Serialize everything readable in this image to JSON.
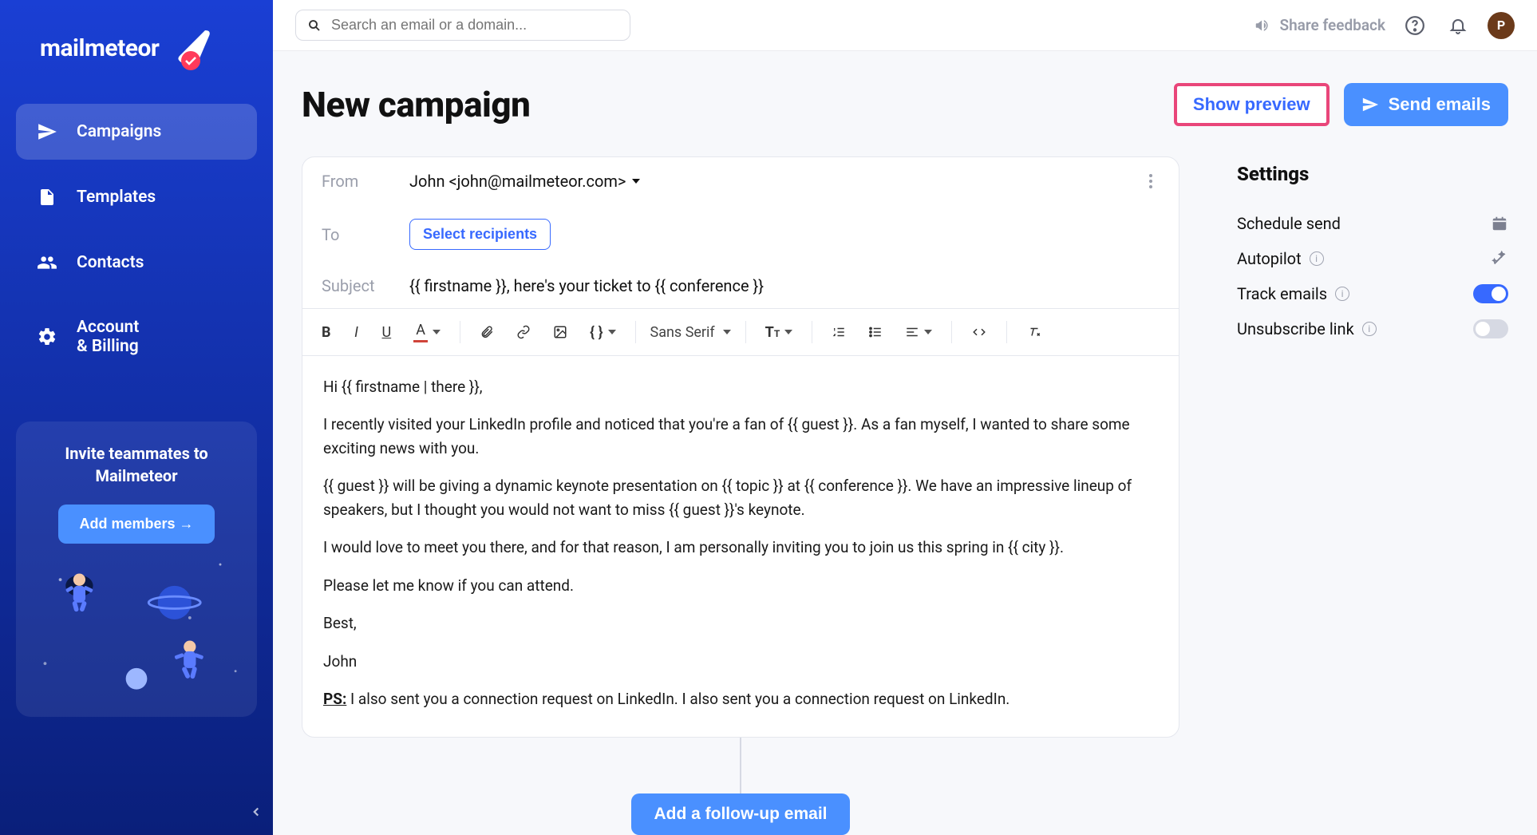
{
  "brand": {
    "name": "mailmeteor"
  },
  "search": {
    "placeholder": "Search an email or a domain..."
  },
  "topbar": {
    "feedback": "Share feedback",
    "avatar_initial": "P"
  },
  "nav": {
    "campaigns": "Campaigns",
    "templates": "Templates",
    "contacts": "Contacts",
    "account_billing_line1": "Account",
    "account_billing_line2": "& Billing"
  },
  "invite": {
    "title": "Invite teammates to Mailmeteor",
    "button": "Add members →"
  },
  "page": {
    "title": "New campaign",
    "show_preview": "Show preview",
    "send_emails": "Send emails",
    "follow_up": "Add a follow-up email"
  },
  "compose": {
    "from_label": "From",
    "from_value": "John <john@mailmeteor.com>",
    "to_label": "To",
    "select_recipients": "Select recipients",
    "subject_label": "Subject",
    "subject_value": "{{ firstname }}, here's your ticket to {{ conference }}",
    "font": "Sans Serif"
  },
  "body": {
    "p1": "Hi {{ firstname | there }},",
    "p2": "I recently visited your LinkedIn profile and noticed that you're a fan of {{ guest }}. As a fan myself, I wanted to share some exciting news with you.",
    "p3": "{{ guest }} will be giving a dynamic keynote presentation on {{ topic }} at {{ conference }}. We have an impressive lineup of speakers, but I thought you would not want to miss {{ guest }}'s keynote.",
    "p4": "I would love to meet you there, and for that reason, I am personally inviting you to join us this spring in {{ city }}.",
    "p5": "Please let me know if you can attend.",
    "p6": "Best,",
    "p7": "John",
    "ps_label": "PS:",
    "ps_text": " I also sent you a connection request on LinkedIn. I also sent you a connection request on LinkedIn."
  },
  "settings": {
    "title": "Settings",
    "schedule": "Schedule send",
    "autopilot": "Autopilot",
    "track": "Track emails",
    "unsubscribe": "Unsubscribe link",
    "track_on": true,
    "unsubscribe_on": false
  },
  "colors": {
    "accent": "#3769ff",
    "highlight_border": "#e9467a",
    "button_blue": "#4a90ff"
  }
}
